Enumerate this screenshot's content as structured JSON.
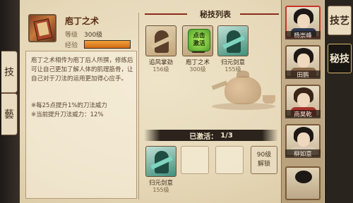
{
  "skill": {
    "name": "庖丁之术",
    "level_label": "等级",
    "level_value": "300级",
    "exp_label": "经验",
    "exp_fraction": 1.0,
    "description": "庖丁之术相传为庖丁后人所撰，修练后可让自己更加了解人体的肌理筋骨，让自己对于刀法的运用更加得心应手。",
    "bonus_1": "※每25点提升1%的刀法威力",
    "bonus_2": "※当前提升刀法威力：12%"
  },
  "list_panel": {
    "title": "秘技列表",
    "cards": [
      {
        "name": "追风掌劲",
        "level": "156级"
      },
      {
        "name": "庖丁之术",
        "level": "300级",
        "action": "点击\n激活"
      },
      {
        "name": "归元剑意",
        "level": "155级"
      }
    ]
  },
  "activated": {
    "label": "已激活：",
    "count": "1/3",
    "slots": [
      {
        "name": "归元剑意",
        "level": "155级"
      }
    ],
    "unlock_level": "90级",
    "unlock_label": "解锁"
  },
  "tabs": {
    "left": [
      "技",
      "藝"
    ],
    "right": [
      "技艺",
      "秘技"
    ],
    "active_right": 1
  },
  "characters": [
    {
      "name": "杨崇峰",
      "selected": true
    },
    {
      "name": "田鹏"
    },
    {
      "name": "商昊乾"
    },
    {
      "name": "柳如意"
    }
  ],
  "colors": {
    "accent_red": "#8c2b1c",
    "exp_orange": "#e58a25",
    "activate_green": "#6cc43a"
  }
}
